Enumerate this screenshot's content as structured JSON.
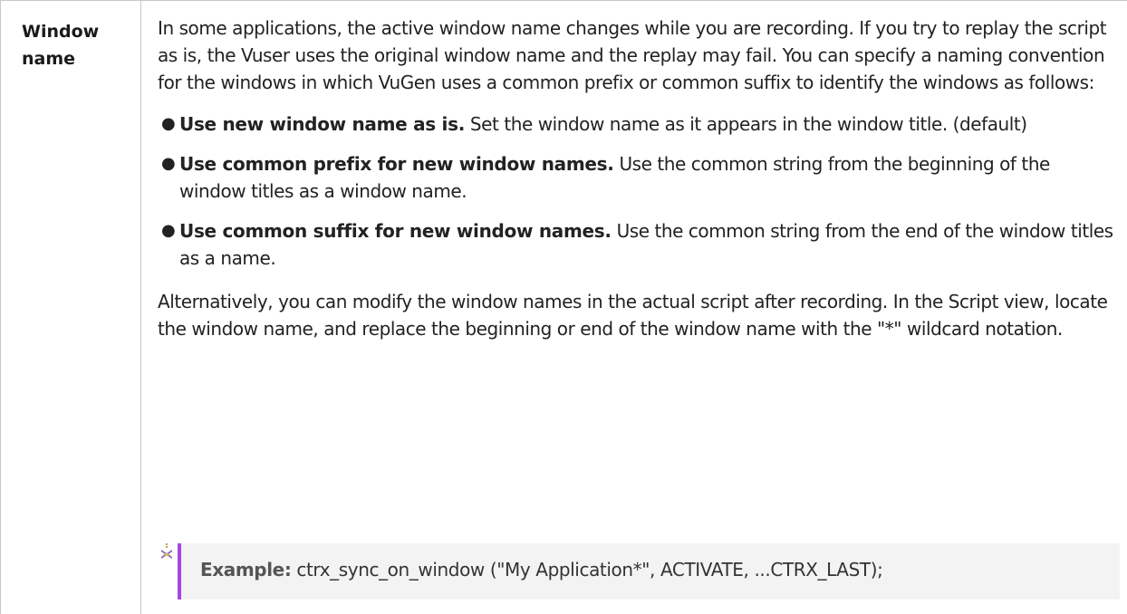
{
  "row": {
    "label": "Window name",
    "intro": "In some applications, the active window name changes while you are recording. If you try to replay the script as is, the Vuser uses the original window name and the replay may fail. You can specify a naming convention for the windows in which VuGen uses a common prefix or common suffix to identify the windows as follows:",
    "options": [
      {
        "title": "Use new window name as is.",
        "text": " Set the window name as it appears in the window title. (default)"
      },
      {
        "title": "Use common prefix for new window names.",
        "text": " Use the common string from the beginning of the window titles as a window name."
      },
      {
        "title": "Use common suffix for new window names.",
        "text": " Use the common string from the end of the window titles as a name."
      }
    ],
    "alternative": "Alternatively, you can modify the window names in the actual script after recording. In the Script view, locate the window name, and replace the beginning or end of the window name with the \"*\" wildcard notation.",
    "example": {
      "label": "Example:",
      "code": " ctrx_sync_on_window (\"My Application*\", ACTIVATE, ...CTRX_LAST);",
      "icon": "example-icon"
    }
  },
  "colors": {
    "accent": "#a347e6",
    "border": "#c8c8c8",
    "example_bg": "#f3f3f3"
  }
}
